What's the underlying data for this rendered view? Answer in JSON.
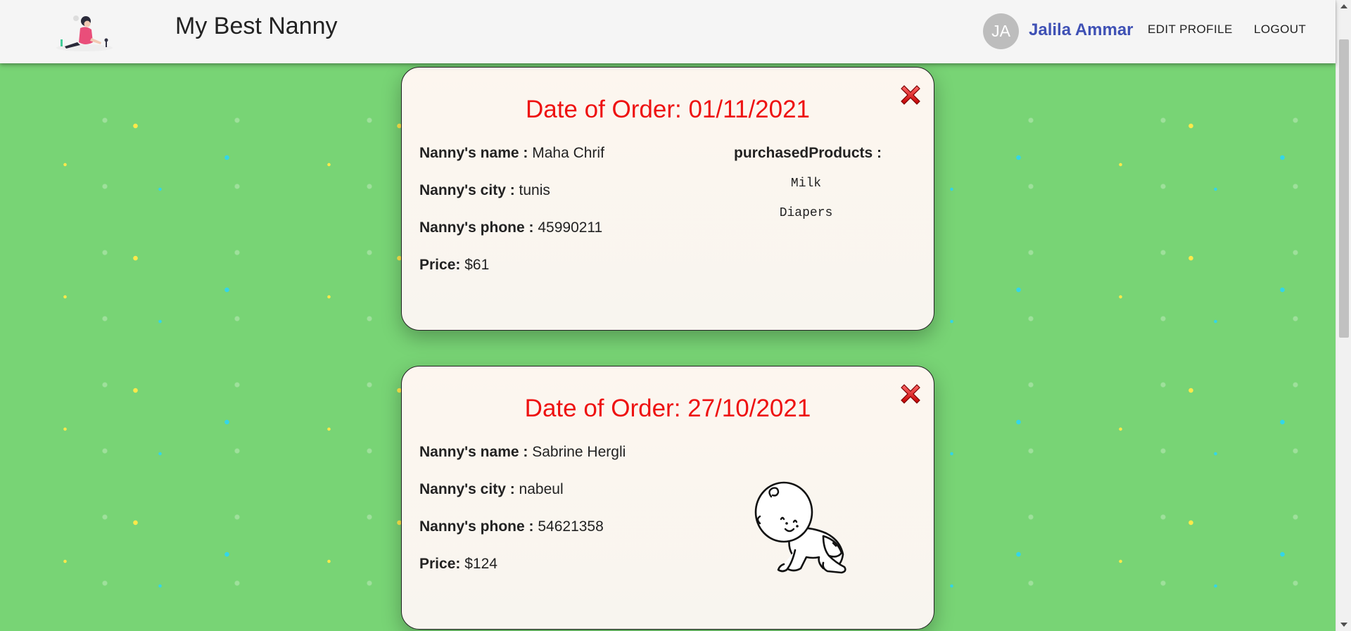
{
  "header": {
    "title": "My Best Nanny",
    "avatar_initials": "JA",
    "user_name": "Jalila Ammar",
    "edit_profile_label": "EDIT PROFILE",
    "logout_label": "LOGOUT"
  },
  "orders": [
    {
      "date_label": "Date of Order: 01/11/2021",
      "name_label": "Nanny's name :",
      "name_value": "Maha Chrif",
      "city_label": "Nanny's city :",
      "city_value": "tunis",
      "phone_label": "Nanny's phone :",
      "phone_value": "45990211",
      "price_label": "Price:",
      "price_value": "$61",
      "products_label": "purchasedProducts :",
      "products": [
        "Milk",
        "Diapers"
      ]
    },
    {
      "date_label": "Date of Order: 27/10/2021",
      "name_label": "Nanny's name :",
      "name_value": "Sabrine Hergli",
      "city_label": "Nanny's city :",
      "city_value": "nabeul",
      "phone_label": "Nanny's phone :",
      "phone_value": "54621358",
      "price_label": "Price:",
      "price_value": "$124",
      "illustration": "crawling-baby-icon"
    }
  ],
  "icons": {
    "close": "close-icon",
    "logo": "nanny-logo-icon"
  },
  "colors": {
    "background": "#78d475",
    "date_red": "#ee1111",
    "user_name_blue": "#3f51b5",
    "card_bg": "#fdf6ef"
  }
}
